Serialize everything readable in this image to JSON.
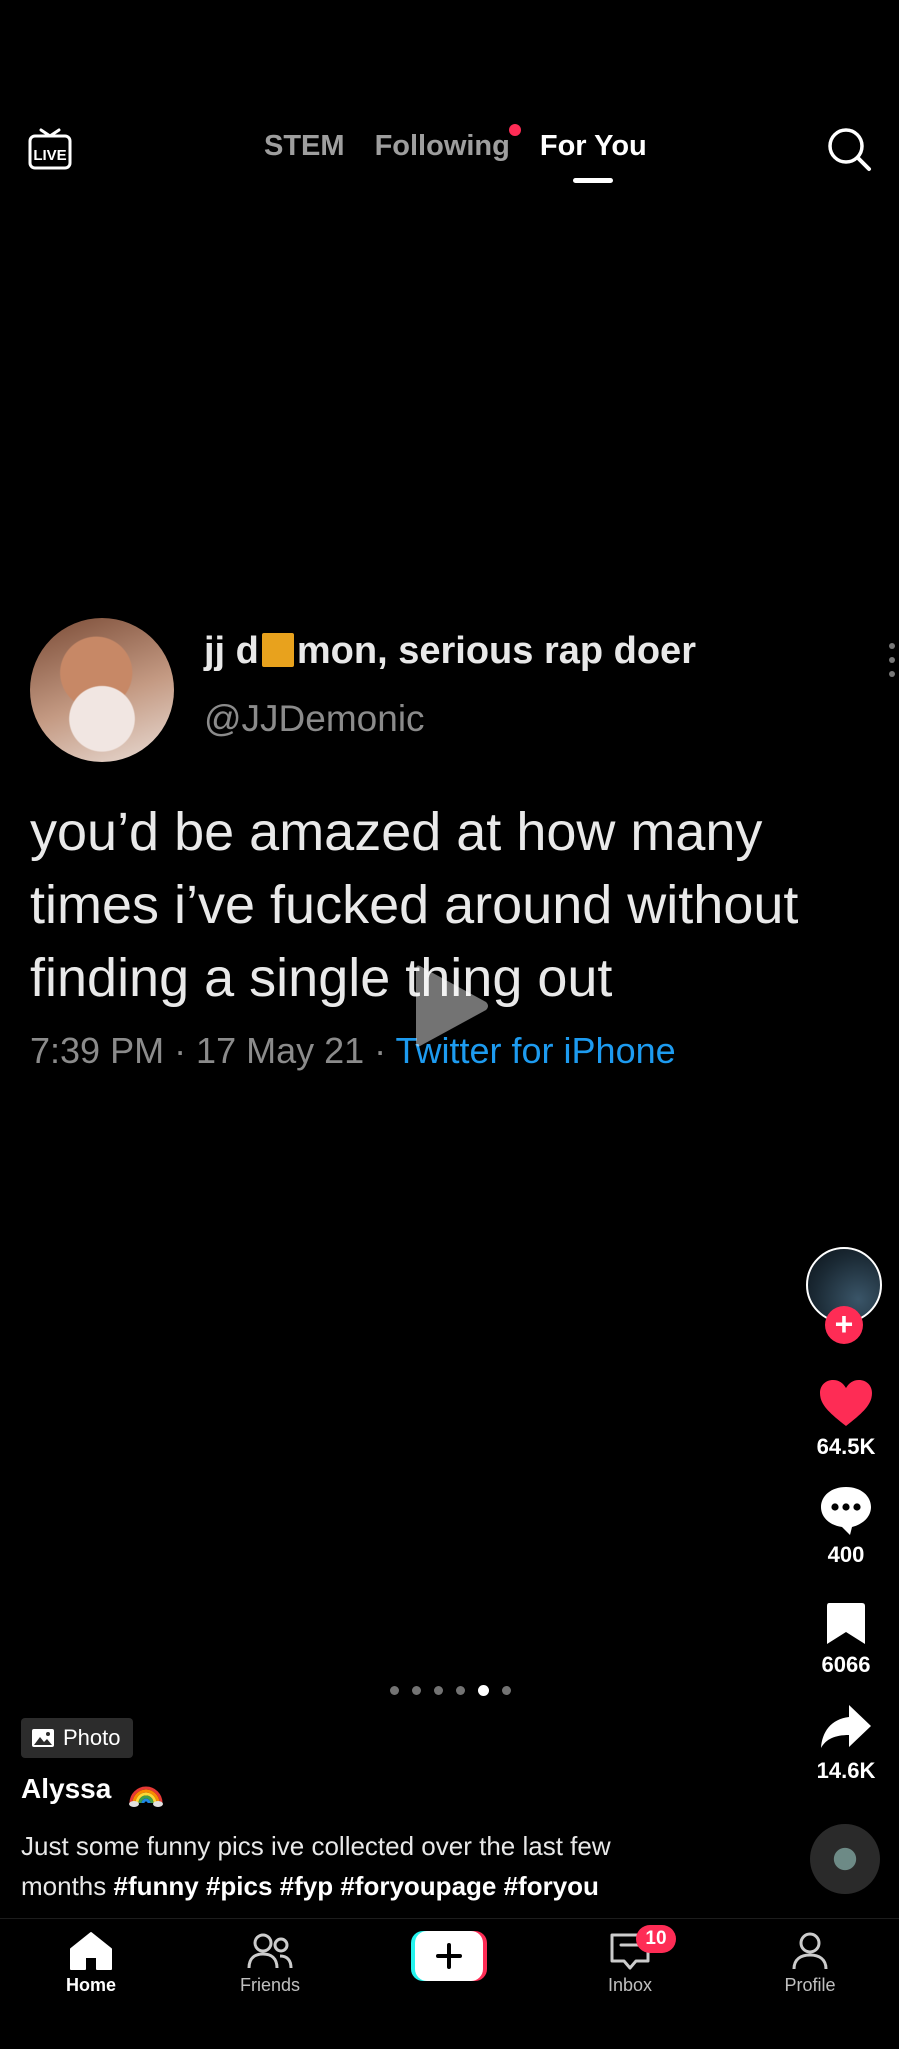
{
  "header": {
    "tabs": [
      {
        "label": "STEM",
        "active": false
      },
      {
        "label": "Following",
        "active": false,
        "has_dot": true
      },
      {
        "label": "For You",
        "active": true
      }
    ],
    "icons": [
      "live-icon",
      "search-icon"
    ]
  },
  "tweet": {
    "display_name_part1": "jj d",
    "display_name_part2": "mon, serious rap doer",
    "handle": "@JJDemonic",
    "text": "you’d be amazed at how many times  i’ve fucked around without finding a single thing out",
    "timestamp": "7:39 PM · 17 May 21 · ",
    "source": "Twitter for iPhone",
    "colors": {
      "source_link": "#1d9bf0"
    }
  },
  "actions": {
    "likes": "64.5K",
    "comments": "400",
    "bookmarks": "6066",
    "shares": "14.6K",
    "follow_symbol": "+"
  },
  "carousel": {
    "count": 6,
    "active_index": 4
  },
  "post": {
    "badge_label": "Photo",
    "username": "Alyssa",
    "caption_text": "Just some funny pics ive collected over the last few months ",
    "hashtags": "#funny #pics #fyp #foryoupage #foryou"
  },
  "bottom_nav": {
    "home": "Home",
    "friends": "Friends",
    "create_symbol": "+",
    "inbox": "Inbox",
    "inbox_badge": "10",
    "profile": "Profile"
  },
  "colors": {
    "accent": "#fe2c55",
    "background": "#000000"
  }
}
